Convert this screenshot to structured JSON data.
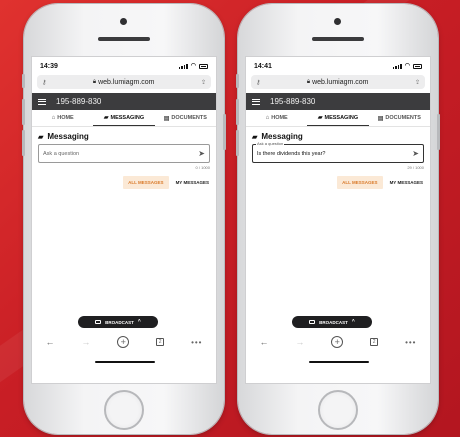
{
  "left": {
    "status_time": "14:39",
    "url": "web.lumiagm.com",
    "meeting_id": "195-889-830",
    "tabs": [
      {
        "label": "HOME",
        "icon": "home-icon",
        "active": false
      },
      {
        "label": "MESSAGING",
        "icon": "messaging-icon",
        "active": true
      },
      {
        "label": "DOCUMENTS",
        "icon": "documents-icon",
        "active": false
      }
    ],
    "section_title": "Messaging",
    "input": {
      "placeholder": "Ask a question",
      "value": "",
      "floating_label": ""
    },
    "counter": "0 / 1000",
    "filters": {
      "all_messages": "ALL MESSAGES",
      "my_messages": "MY MESSAGES"
    },
    "broadcast_label": "BROADCAST",
    "tab_count": "2"
  },
  "right": {
    "status_time": "14:41",
    "url": "web.lumiagm.com",
    "meeting_id": "195-889-830",
    "tabs": [
      {
        "label": "HOME",
        "icon": "home-icon",
        "active": false
      },
      {
        "label": "MESSAGING",
        "icon": "messaging-icon",
        "active": true
      },
      {
        "label": "DOCUMENTS",
        "icon": "documents-icon",
        "active": false
      }
    ],
    "section_title": "Messaging",
    "input": {
      "placeholder": "",
      "value": "Is there dividends this year?",
      "floating_label": "Ask a question"
    },
    "counter": "29 / 1000",
    "filters": {
      "all_messages": "ALL MESSAGES",
      "my_messages": "MY MESSAGES"
    },
    "broadcast_label": "BROADCAST",
    "tab_count": "2"
  },
  "colors": {
    "background": "#d22a2a",
    "header": "#3c3c3e",
    "accent_orange": "#d97a2a",
    "accent_orange_bg": "#fbe9d6",
    "broadcast_bg": "#1f1f21"
  }
}
